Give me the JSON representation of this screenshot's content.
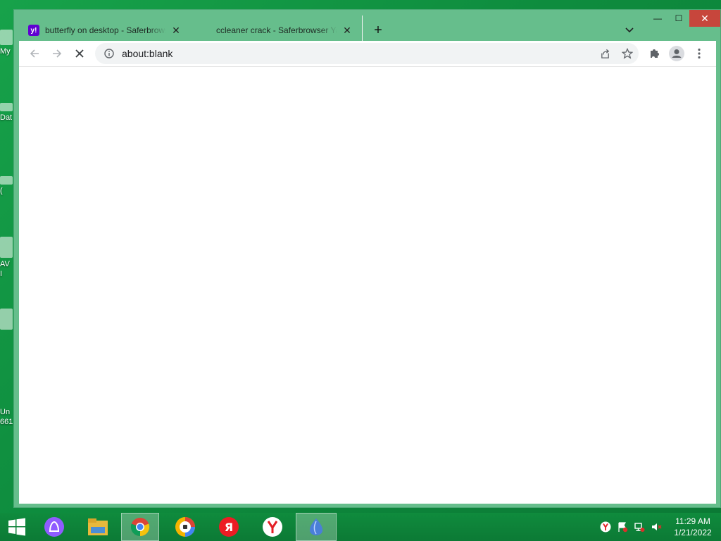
{
  "desktop": {
    "icons": [
      {
        "label": "My"
      },
      {
        "label": "Dat"
      },
      {
        "label": "("
      },
      {
        "label": "AV"
      },
      {
        "label": "I"
      },
      {
        "label": "Un"
      },
      {
        "label": "661"
      }
    ]
  },
  "browser": {
    "tabs": [
      {
        "title": "butterfly on desktop - Saferbrowser Yahoo Search Results",
        "favicon": "yahoo-icon",
        "favicon_text": "y!",
        "active": true
      },
      {
        "title": "ccleaner crack - Saferbrowser Yahoo Search Results",
        "favicon": "loading-icon",
        "active": false
      }
    ],
    "new_tab": "+",
    "address": {
      "url": "about:blank"
    },
    "window_controls": {
      "minimize": "—",
      "maximize": "☐",
      "close": "✕"
    }
  },
  "taskbar": {
    "apps": [
      {
        "name": "start-button"
      },
      {
        "name": "alice-assistant-icon"
      },
      {
        "name": "file-explorer-icon"
      },
      {
        "name": "chrome-icon",
        "selected": true
      },
      {
        "name": "browser-shield-icon"
      },
      {
        "name": "yandex-browser-icon"
      },
      {
        "name": "yandex-y-icon"
      },
      {
        "name": "app-window-icon",
        "selected": true
      }
    ],
    "clock": {
      "time": "11:29 AM",
      "date": "1/21/2022"
    }
  },
  "colors": {
    "window_frame": "#66be8c",
    "desktop": "#0e8c3e",
    "close_button": "#c7463c",
    "yahoo": "#6001d2"
  }
}
